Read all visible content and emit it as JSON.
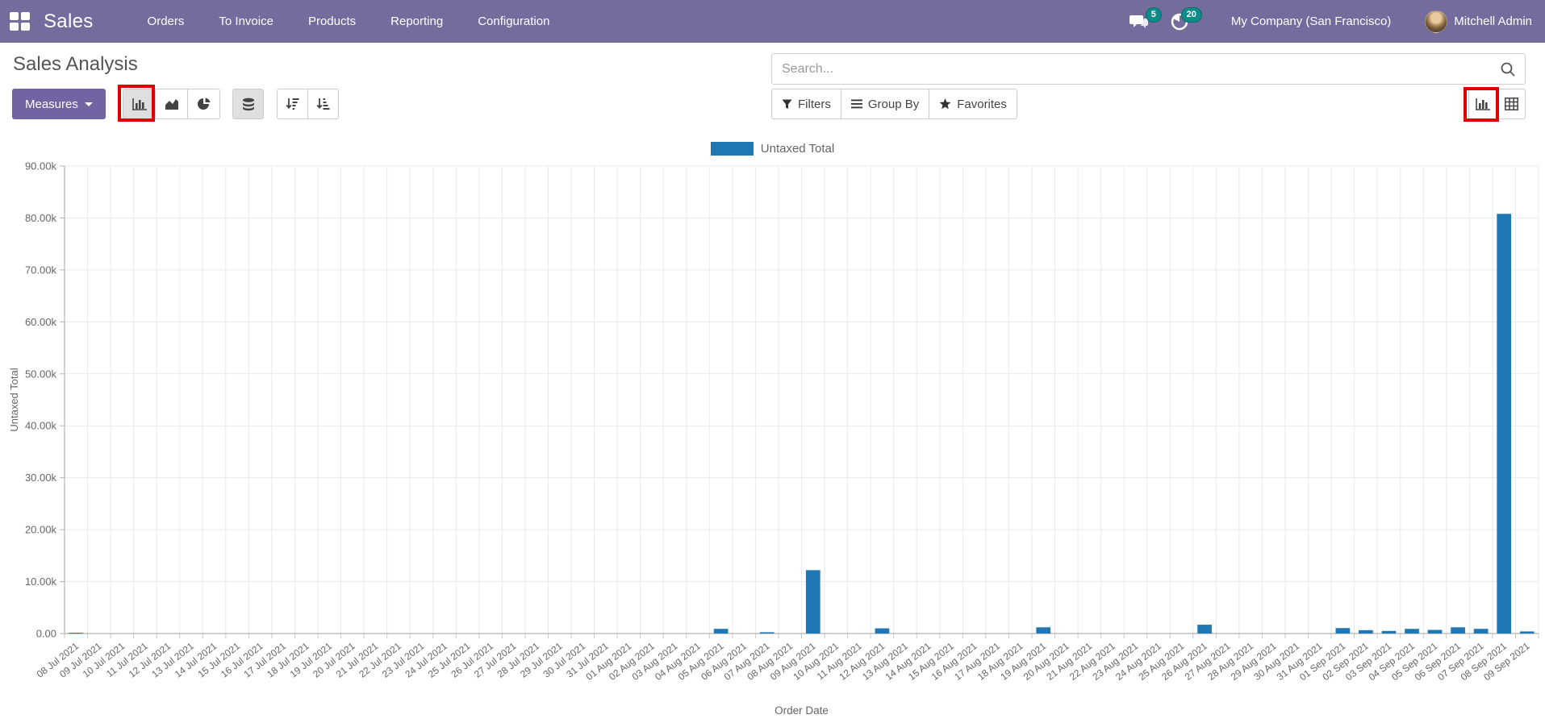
{
  "colors": {
    "navbar_bg": "#756C9E",
    "primary_btn": "#7264A2",
    "badge_bg": "#0E8C8A",
    "annotation": "#E10000",
    "bar_color": "#1F77B4"
  },
  "navbar": {
    "app_name": "Sales",
    "menu_items": [
      "Orders",
      "To Invoice",
      "Products",
      "Reporting",
      "Configuration"
    ],
    "messages_badge": "5",
    "activities_badge": "20",
    "company": "My Company (San Francisco)",
    "user": "Mitchell Admin"
  },
  "control_panel": {
    "title": "Sales Analysis",
    "search_placeholder": "Search...",
    "measures_label": "Measures",
    "filters_label": "Filters",
    "group_by_label": "Group By",
    "favorites_label": "Favorites"
  },
  "chart_data": {
    "type": "bar",
    "title": "",
    "xlabel": "Order Date",
    "ylabel": "Untaxed Total",
    "ylim": [
      0,
      90000
    ],
    "grid": true,
    "legend_position": "top",
    "ytick_labels": [
      "0.00",
      "10.00k",
      "20.00k",
      "30.00k",
      "40.00k",
      "50.00k",
      "60.00k",
      "70.00k",
      "80.00k",
      "90.00k"
    ],
    "categories": [
      "08 Jul 2021",
      "09 Jul 2021",
      "10 Jul 2021",
      "11 Jul 2021",
      "12 Jul 2021",
      "13 Jul 2021",
      "14 Jul 2021",
      "15 Jul 2021",
      "16 Jul 2021",
      "17 Jul 2021",
      "18 Jul 2021",
      "19 Jul 2021",
      "20 Jul 2021",
      "21 Jul 2021",
      "22 Jul 2021",
      "23 Jul 2021",
      "24 Jul 2021",
      "25 Jul 2021",
      "26 Jul 2021",
      "27 Jul 2021",
      "28 Jul 2021",
      "29 Jul 2021",
      "30 Jul 2021",
      "31 Jul 2021",
      "01 Aug 2021",
      "02 Aug 2021",
      "03 Aug 2021",
      "04 Aug 2021",
      "05 Aug 2021",
      "06 Aug 2021",
      "07 Aug 2021",
      "08 Aug 2021",
      "09 Aug 2021",
      "10 Aug 2021",
      "11 Aug 2021",
      "12 Aug 2021",
      "13 Aug 2021",
      "14 Aug 2021",
      "15 Aug 2021",
      "16 Aug 2021",
      "17 Aug 2021",
      "18 Aug 2021",
      "19 Aug 2021",
      "20 Aug 2021",
      "21 Aug 2021",
      "22 Aug 2021",
      "23 Aug 2021",
      "24 Aug 2021",
      "25 Aug 2021",
      "26 Aug 2021",
      "27 Aug 2021",
      "28 Aug 2021",
      "29 Aug 2021",
      "30 Aug 2021",
      "31 Aug 2021",
      "01 Sep 2021",
      "02 Sep 2021",
      "03 Sep 2021",
      "04 Sep 2021",
      "05 Sep 2021",
      "06 Sep 2021",
      "07 Sep 2021",
      "08 Sep 2021",
      "09 Sep 2021"
    ],
    "series": [
      {
        "name": "Untaxed Total",
        "color": "#1F77B4",
        "values": [
          80,
          0,
          0,
          0,
          0,
          0,
          0,
          0,
          0,
          0,
          0,
          0,
          0,
          0,
          0,
          0,
          0,
          0,
          0,
          0,
          0,
          0,
          0,
          0,
          0,
          0,
          0,
          0,
          900,
          0,
          250,
          0,
          12200,
          0,
          0,
          1000,
          0,
          0,
          0,
          0,
          0,
          0,
          1200,
          0,
          0,
          0,
          0,
          0,
          0,
          1700,
          0,
          0,
          0,
          0,
          0,
          1050,
          650,
          500,
          900,
          700,
          1200,
          900,
          80800,
          400
        ]
      }
    ]
  }
}
